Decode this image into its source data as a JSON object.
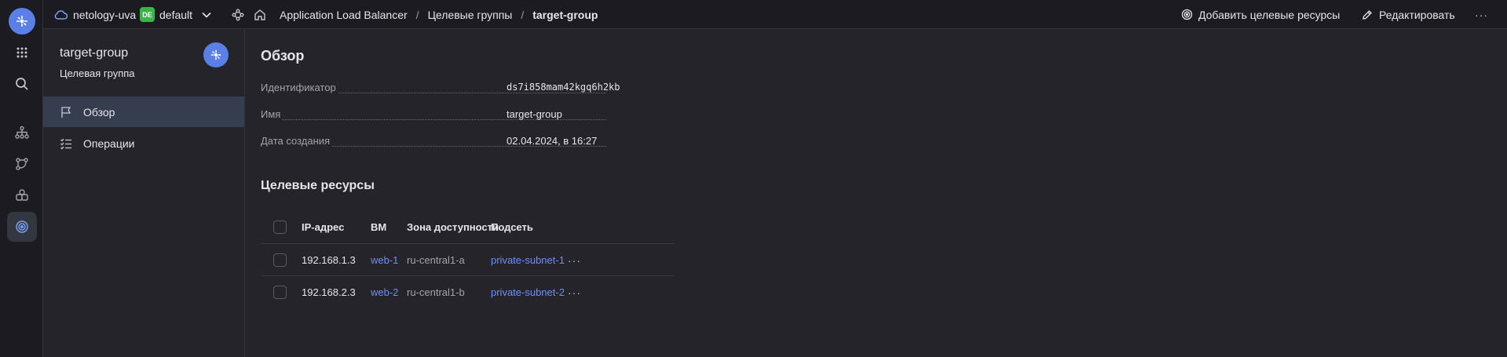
{
  "topbar": {
    "cloud_name": "netology-uva",
    "folder_badge": "DE",
    "folder_name": "default",
    "breadcrumb": {
      "service": "Application Load Balancer",
      "section": "Целевые группы",
      "current": "target-group"
    },
    "actions": {
      "add_targets": "Добавить целевые ресурсы",
      "edit": "Редактировать",
      "more": "···"
    }
  },
  "sidebar": {
    "title": "target-group",
    "subtitle": "Целевая группа",
    "items": [
      {
        "label": "Обзор",
        "icon": "flag-icon",
        "active": true
      },
      {
        "label": "Операции",
        "icon": "list-checks-icon",
        "active": false
      }
    ]
  },
  "overview": {
    "heading": "Обзор",
    "properties": [
      {
        "label": "Идентификатор",
        "value": "ds7i858mam42kgq6h2kb"
      },
      {
        "label": "Имя",
        "value": "target-group"
      },
      {
        "label": "Дата создания",
        "value": "02.04.2024, в 16:27"
      }
    ]
  },
  "targets": {
    "heading": "Целевые ресурсы",
    "columns": [
      "IP-адрес",
      "ВМ",
      "Зона доступности",
      "Подсеть"
    ],
    "rows": [
      {
        "ip": "192.168.1.3",
        "vm": "web-1",
        "zone": "ru-central1-a",
        "subnet": "private-subnet-1",
        "more": "···"
      },
      {
        "ip": "192.168.2.3",
        "vm": "web-2",
        "zone": "ru-central1-b",
        "subnet": "private-subnet-2",
        "more": "···"
      }
    ]
  },
  "colors": {
    "accent": "#5a7fe6",
    "link": "#6f8ff7",
    "badge": "#3ab54a",
    "background": "#25242a"
  }
}
